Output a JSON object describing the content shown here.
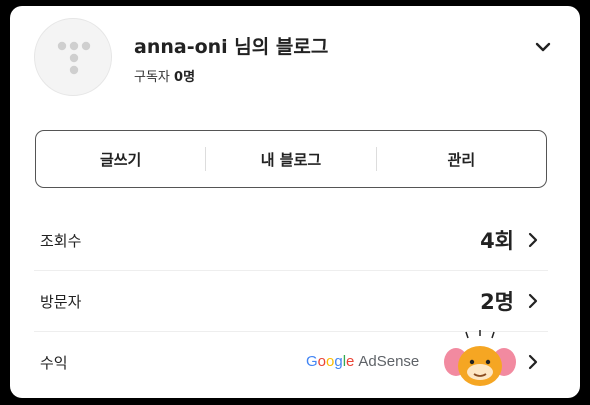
{
  "header": {
    "blog_title": "anna-oni 님의 블로그",
    "subscriber_label": "구독자",
    "subscriber_count": "0명"
  },
  "actions": {
    "write": "글쓰기",
    "my_blog": "내 블로그",
    "manage": "관리"
  },
  "stats": {
    "views": {
      "label": "조회수",
      "value": "4회"
    },
    "visitors": {
      "label": "방문자",
      "value": "2명"
    },
    "revenue": {
      "label": "수익",
      "provider_google": "Google",
      "provider_product": "AdSense"
    }
  },
  "icons": {
    "avatar": "tistory-logo-icon",
    "expand": "chevron-down-icon",
    "row_arrow": "chevron-right-icon",
    "mascot": "character-mascot-icon"
  },
  "colors": {
    "card_bg": "#ffffff",
    "page_bg": "#000000",
    "text": "#222222",
    "avatar_dots": "#cfcfcf"
  }
}
